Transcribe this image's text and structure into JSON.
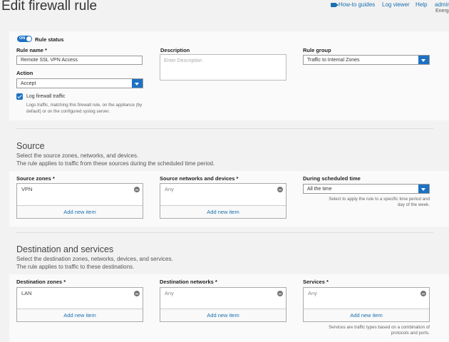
{
  "header": {
    "title": "Edit firewall rule",
    "nav": {
      "howto": "How-to guides",
      "log_viewer": "Log viewer",
      "help": "Help",
      "user": "admin"
    },
    "org": "Energ"
  },
  "rule": {
    "status_toggle": "ON",
    "status_label": "Rule status",
    "name_label": "Rule name *",
    "name_value": "Remote SSL VPN Access",
    "description_label": "Description",
    "description_placeholder": "Enter Description",
    "group_label": "Rule group",
    "group_value": "Traffic to Internal Zones",
    "action_label": "Action",
    "action_value": "Accept",
    "log_label": "Log firewall traffic",
    "log_help_1": "Logs traffic, matching this firewall rule, on the appliance (by",
    "log_help_2": "default) or on the configured syslog server."
  },
  "source": {
    "title": "Source",
    "desc_1": "Select the source zones, networks, and devices.",
    "desc_2": "The rule applies to traffic from these sources during the scheduled time period.",
    "zones_label": "Source zones *",
    "zones_item": "VPN",
    "networks_label": "Source networks and devices *",
    "networks_item": "Any",
    "schedule_label": "During scheduled time",
    "schedule_value": "All the time",
    "schedule_help_1": "Select to apply the rule to a specific time period and",
    "schedule_help_2": "day of the week.",
    "add_new": "Add new item"
  },
  "destination": {
    "title": "Destination and services",
    "desc_1": "Select the destination zones, networks, devices, and services.",
    "desc_2": "The rule applies to traffic to these destinations.",
    "zones_label": "Destination zones *",
    "zones_item": "LAN",
    "networks_label": "Destination networks *",
    "networks_item": "Any",
    "services_label": "Services *",
    "services_item": "Any",
    "services_help_1": "Services are traffic types based on a combination of",
    "services_help_2": "protocols and ports.",
    "add_new": "Add new item"
  }
}
